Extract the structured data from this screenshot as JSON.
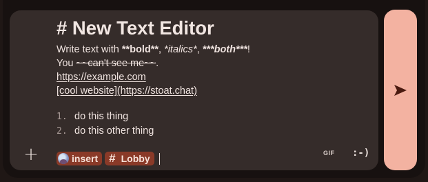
{
  "composer": {
    "heading": "# New Text Editor",
    "line1": {
      "a": "Write text with ",
      "bold": "**bold**",
      "sep1": ", ",
      "italic": "*italics*",
      "sep2": ", ",
      "both": "***both***",
      "end": "!"
    },
    "line2": {
      "a": "You ",
      "strike": "~~can't see me~~",
      "end": "."
    },
    "link1": "https://example.com",
    "link2": "[cool website](https://stoat.chat)",
    "list": [
      {
        "num": "1.",
        "text": "do this thing"
      },
      {
        "num": "2.",
        "text": "do this other thing"
      }
    ],
    "mention_user": "insert",
    "mention_channel": "Lobby",
    "channel_hash": "#"
  },
  "toolbar": {
    "add_label": "+",
    "gif_label": "GIF",
    "emoji_label": ":-)"
  },
  "icons": {
    "add": "plus-icon",
    "send": "send-arrow-icon"
  },
  "colors": {
    "composer_bg": "#352c2a",
    "chip_bg": "#8a3a28",
    "send_bg": "#f3b2a1",
    "send_icon": "#4a1a10"
  }
}
